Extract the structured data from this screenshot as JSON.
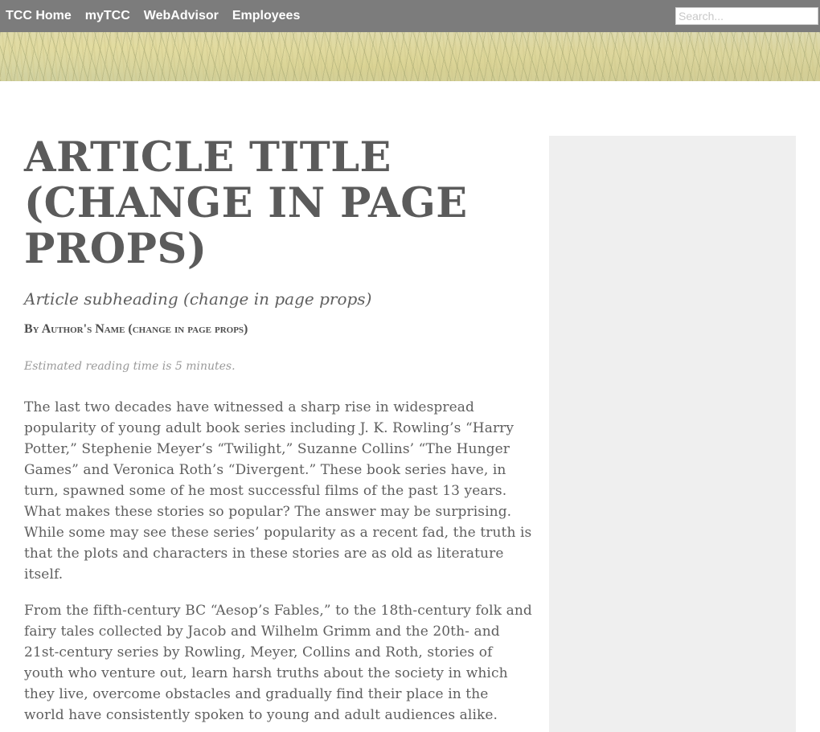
{
  "nav": {
    "links": [
      {
        "label": "TCC Home"
      },
      {
        "label": "myTCC"
      },
      {
        "label": "WebAdvisor"
      },
      {
        "label": "Employees"
      }
    ],
    "search_placeholder": "Search..."
  },
  "article": {
    "title": "Article Title (change in page props)",
    "subheading": "Article subheading (change in page props)",
    "byline": "By Author's Name (change in page props)",
    "reading_time": "Estimated reading time is 5 minutes.",
    "paragraphs": [
      "The last two decades have witnessed a sharp rise in widespread popularity of young adult book series including J. K. Rowling’s “Harry Potter,” Stephenie Meyer’s “Twilight,” Suzanne Collins’ “The Hunger Games” and Veronica Roth’s “Divergent.” These book series have, in turn, spawned some of he most successful films of the past 13 years. What makes these stories so popular? The answer may be surprising. While some may see these series’ popularity as a recent fad, the truth is that the plots and characters in these stories are as old as literature itself.",
      "From the fifth-century BC “Aesop’s Fables,” to the 18th-century folk and fairy tales collected by Jacob and Wilhelm Grimm and the 20th- and 21st-century series by Rowling, Meyer, Collins and Roth, stories of youth who venture out, learn harsh truths about the society in which they live, overcome obstacles and gradually find their place in the world have consistently spoken to young and adult audiences alike."
    ]
  },
  "colors": {
    "topbar": "#7c7c7c",
    "title_text": "#5b5b5b",
    "body_text": "#5e5e5e",
    "sidebar": "#efefef"
  }
}
